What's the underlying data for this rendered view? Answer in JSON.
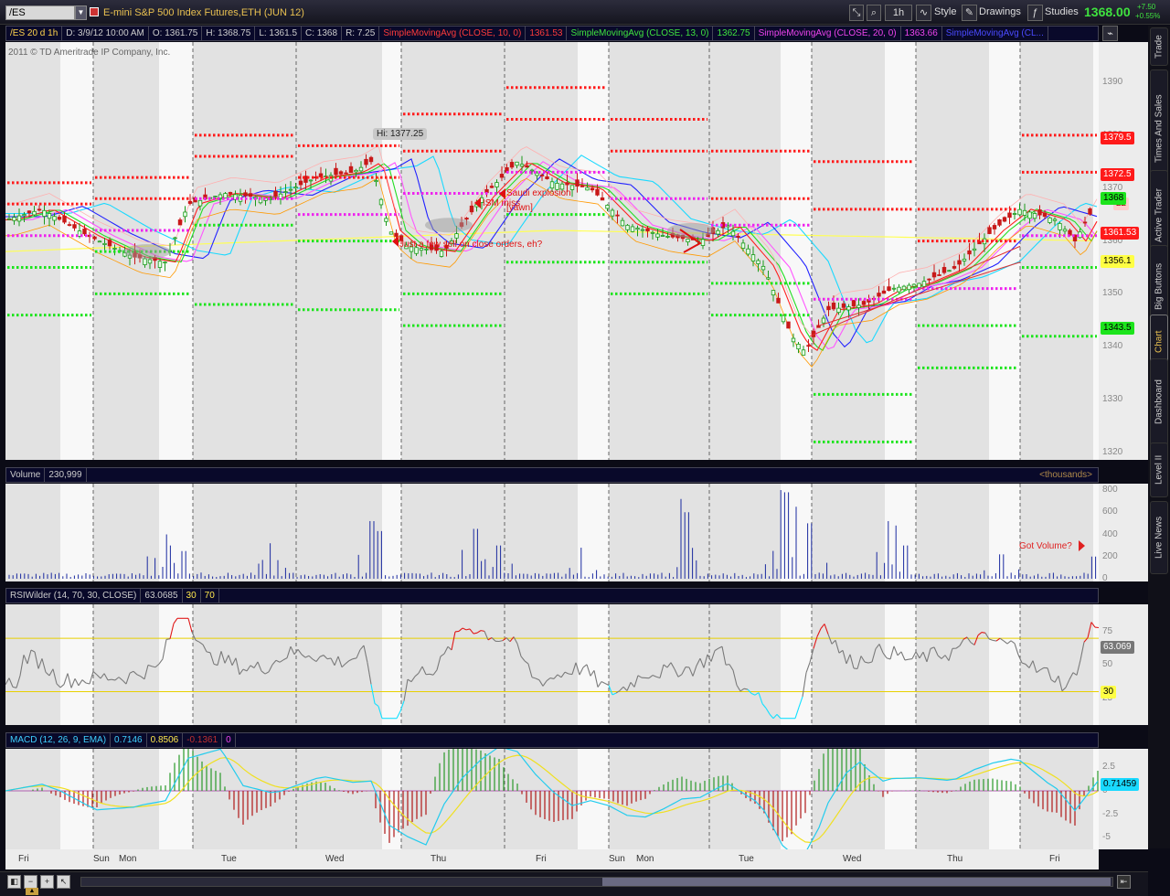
{
  "topbar": {
    "symbol": "/ES",
    "description": "E-mini S&P 500 Index Futures,ETH (JUN 12)",
    "timeframe_button": "1h",
    "style_label": "Style",
    "drawings_label": "Drawings",
    "studies_label": "Studies",
    "last_price": "1368.00",
    "change_abs": "+7.50",
    "change_pct": "+0.55%"
  },
  "sidetabs": [
    "Trade",
    "Times And Sales",
    "Active Trader",
    "Big Buttons",
    "Chart",
    "Dashboard",
    "Level II",
    "Live News"
  ],
  "price_panel": {
    "header": {
      "aggregation": "/ES 20 d 1h",
      "date": "D: 3/9/12 10:00 AM",
      "open": "O: 1361.75",
      "high": "H: 1368.75",
      "low": "L: 1361.5",
      "close": "C: 1368",
      "range": "R: 7.25",
      "sma10_label": "SimpleMovingAvg (CLOSE, 10, 0)",
      "sma10_value": "1361.53",
      "sma13_label": "SimpleMovingAvg (CLOSE, 13, 0)",
      "sma13_value": "1362.75",
      "sma20_label": "SimpleMovingAvg (CLOSE, 20, 0)",
      "sma20_value": "1363.66",
      "sma_extra_label": "SimpleMovingAvg (CL..."
    },
    "copyright": "2011 © TD Ameritrade IP Company, Inc.",
    "y_ticks": [
      "1390",
      "1380",
      "1370",
      "1360",
      "1350",
      "1340",
      "1330",
      "1320"
    ],
    "flags": {
      "r1": "1379.5",
      "r2": "1372.5",
      "last": "1368",
      "last_extra": "22",
      "sma": "1361.53",
      "y1": "1356.1",
      "g1": "1343.5"
    },
    "hi_label": "Hi: 1377.25",
    "annotations": {
      "saudi": "Saudi explosion",
      "ism1": "ISM miss",
      "ism2": "[yawn]",
      "sell": "Just a few sell on close orders, eh?"
    },
    "colors": {
      "sma10": "#ff2a2a",
      "sma13": "#22d822",
      "sma20": "#e23ce2",
      "sma_extra": "#2a2aff",
      "pivot_red": "#ff1a1a",
      "pivot_green": "#1ce41c",
      "pivot_magenta": "#ee22ee"
    }
  },
  "volume_panel": {
    "header": {
      "label": "Volume",
      "value": "230,999",
      "unit": "<thousands>"
    },
    "y_ticks": [
      "800",
      "600",
      "400",
      "200",
      "0"
    ],
    "annotation": "Got Volume?"
  },
  "rsi_panel": {
    "header": {
      "label": "RSIWilder (14, 70, 30, CLOSE)",
      "value": "63.0685",
      "lo": "30",
      "hi": "70"
    },
    "y_ticks": [
      "75",
      "50",
      "25"
    ],
    "flags": {
      "value": "63.069",
      "lo": "30"
    }
  },
  "macd_panel": {
    "header": {
      "label": "MACD (12, 26, 9, EMA)",
      "value": "0.7146",
      "avg": "0.8506",
      "diff": "-0.1361",
      "zero": "0"
    },
    "y_ticks": [
      "2.5",
      "0",
      "-2.5",
      "-5"
    ],
    "flags": {
      "value": "0.71459"
    }
  },
  "time_axis": [
    "Fri",
    "Sun",
    "Mon",
    "Tue",
    "Wed",
    "Thu",
    "Fri",
    "Sun",
    "Mon",
    "Tue",
    "Wed",
    "Thu",
    "Fri"
  ]
}
